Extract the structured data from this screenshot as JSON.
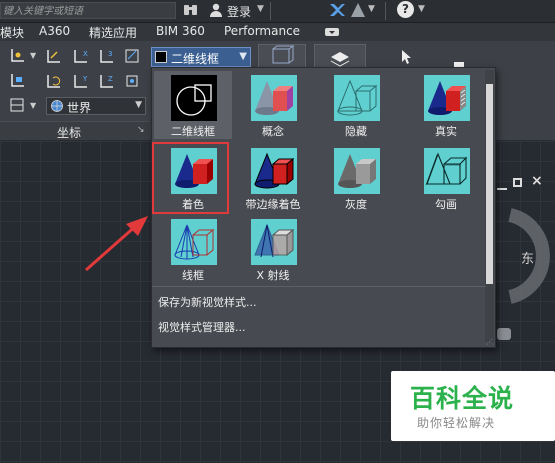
{
  "titlebar": {
    "search_placeholder": "键入关键字或短语",
    "login_label": "登录"
  },
  "menubar": {
    "items": [
      "模块",
      "A360",
      "精选应用",
      "BIM 360",
      "Performance"
    ]
  },
  "ribbon": {
    "coord_dropdown_value": "世界",
    "panel_label": "坐标"
  },
  "visual_style": {
    "current": "二维线框"
  },
  "styles": [
    {
      "label": "二维线框",
      "kind": "wireframe2d"
    },
    {
      "label": "概念",
      "kind": "concept"
    },
    {
      "label": "隐藏",
      "kind": "hidden"
    },
    {
      "label": "真实",
      "kind": "realistic"
    },
    {
      "label": "着色",
      "kind": "shaded",
      "highlighted": true
    },
    {
      "label": "带边缘着色",
      "kind": "shaded_edges"
    },
    {
      "label": "灰度",
      "kind": "grayscale"
    },
    {
      "label": "勾画",
      "kind": "sketchy"
    },
    {
      "label": "线框",
      "kind": "wireframe"
    },
    {
      "label": "X 射线",
      "kind": "xray"
    }
  ],
  "dropdown_actions": {
    "save_new": "保存为新视觉样式...",
    "manager": "视觉样式管理器..."
  },
  "viewcube": {
    "east_label": "东"
  },
  "watermark": {
    "title": "百科全说",
    "subtitle": "助你轻松解决"
  },
  "colors": {
    "highlight": "#e23a3a",
    "annotation_arrow": "#e23a3a",
    "thumb_bg": "#5fcfcf",
    "watermark_green": "#2bb24c"
  }
}
